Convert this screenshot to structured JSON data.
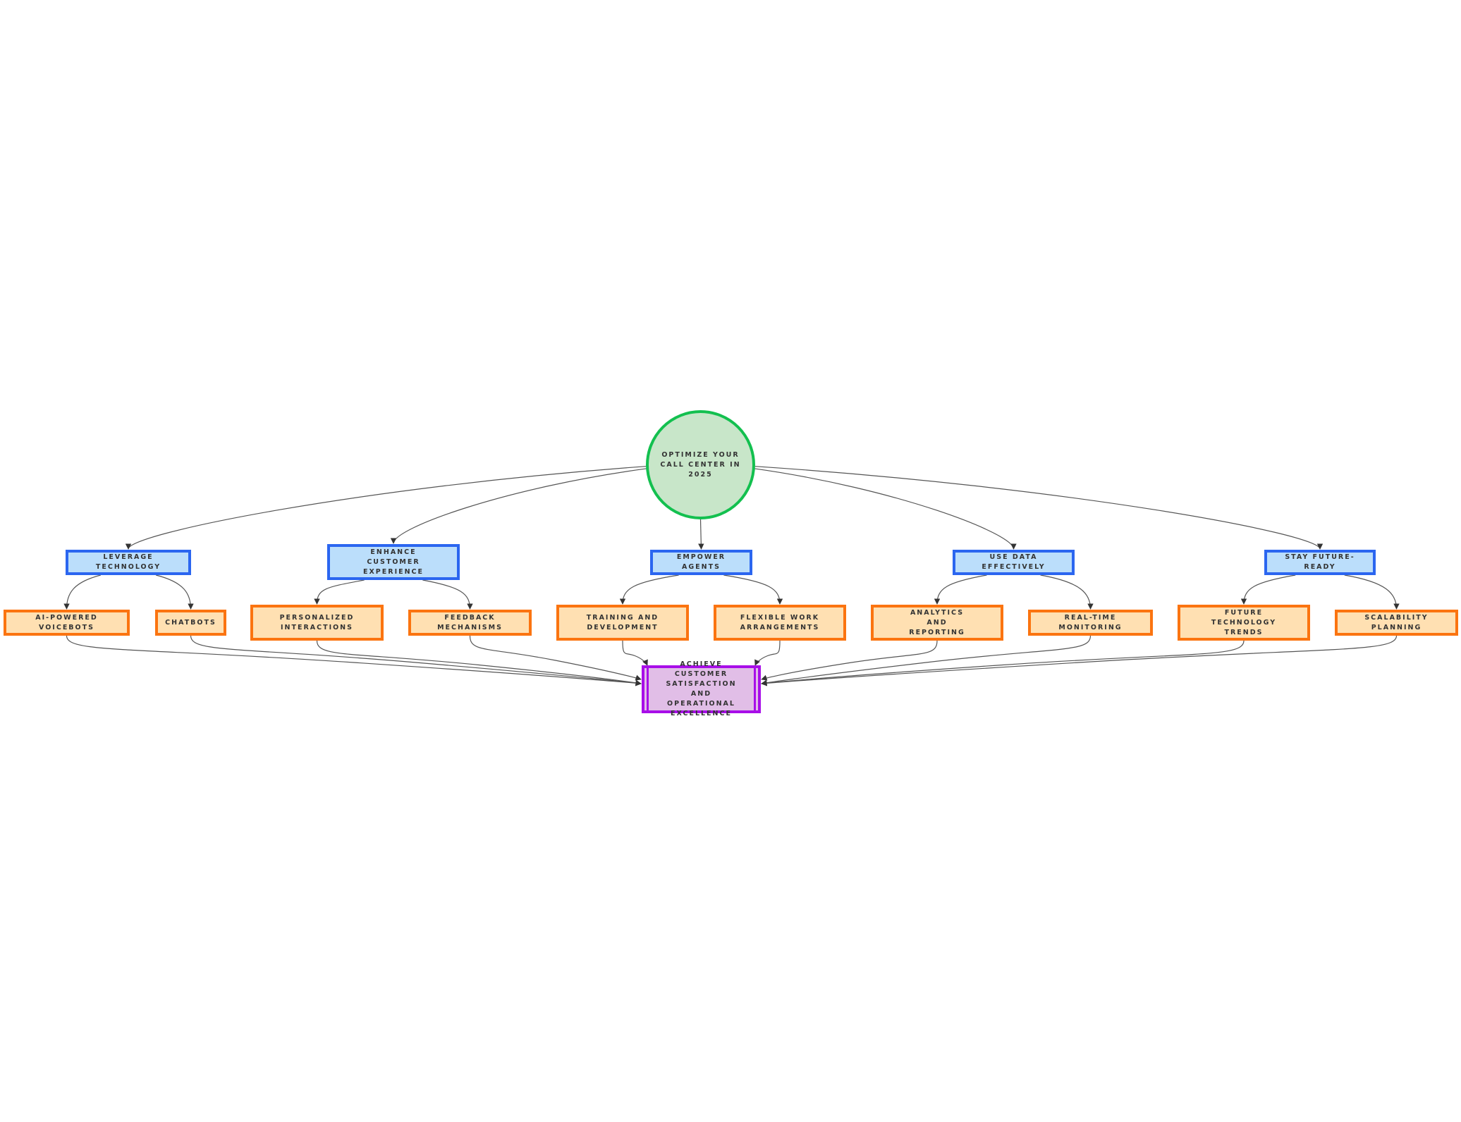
{
  "diagram": {
    "type": "flowchart",
    "root": {
      "id": "root",
      "label": "Optimize Your Call Center in 2025",
      "shape": "circle"
    },
    "pillars": [
      {
        "id": "p1",
        "label": "Leverage Technology",
        "children": [
          {
            "id": "c1",
            "label": "AI-Powered Voicebots"
          },
          {
            "id": "c2",
            "label": "Chatbots"
          }
        ]
      },
      {
        "id": "p2",
        "label": "Enhance Customer Experience",
        "children": [
          {
            "id": "c3",
            "label": "Personalized Interactions"
          },
          {
            "id": "c4",
            "label": "Feedback Mechanisms"
          }
        ]
      },
      {
        "id": "p3",
        "label": "Empower Agents",
        "children": [
          {
            "id": "c5",
            "label": "Training and Development"
          },
          {
            "id": "c6",
            "label": "Flexible Work Arrangements"
          }
        ]
      },
      {
        "id": "p4",
        "label": "Use Data Effectively",
        "children": [
          {
            "id": "c7",
            "label": "Analytics and Reporting"
          },
          {
            "id": "c8",
            "label": "Real-Time Monitoring"
          }
        ]
      },
      {
        "id": "p5",
        "label": "Stay Future-Ready",
        "children": [
          {
            "id": "c9",
            "label": "Future Technology Trends"
          },
          {
            "id": "c10",
            "label": "Scalability Planning"
          }
        ]
      }
    ],
    "goal": {
      "id": "goal",
      "label": "Achieve Customer Satisfaction and Operational Excellence",
      "shape": "subroutine"
    },
    "edges": [
      [
        "root",
        "p1"
      ],
      [
        "root",
        "p2"
      ],
      [
        "root",
        "p3"
      ],
      [
        "root",
        "p4"
      ],
      [
        "root",
        "p5"
      ],
      [
        "p1",
        "c1"
      ],
      [
        "p1",
        "c2"
      ],
      [
        "p2",
        "c3"
      ],
      [
        "p2",
        "c4"
      ],
      [
        "p3",
        "c5"
      ],
      [
        "p3",
        "c6"
      ],
      [
        "p4",
        "c7"
      ],
      [
        "p4",
        "c8"
      ],
      [
        "p5",
        "c9"
      ],
      [
        "p5",
        "c10"
      ],
      [
        "c1",
        "goal"
      ],
      [
        "c2",
        "goal"
      ],
      [
        "c3",
        "goal"
      ],
      [
        "c4",
        "goal"
      ],
      [
        "c5",
        "goal"
      ],
      [
        "c6",
        "goal"
      ],
      [
        "c7",
        "goal"
      ],
      [
        "c8",
        "goal"
      ],
      [
        "c9",
        "goal"
      ],
      [
        "c10",
        "goal"
      ]
    ],
    "colors": {
      "root_fill": "#c8e6c9",
      "root_stroke": "#13c04f",
      "pillar_fill": "#bbdefb",
      "pillar_stroke": "#2b66f0",
      "leaf_fill": "#ffe0b2",
      "leaf_stroke": "#fb7410",
      "goal_fill": "#e1bee7",
      "goal_stroke": "#a80ee8",
      "edge": "#555555",
      "text": "#333333"
    }
  }
}
